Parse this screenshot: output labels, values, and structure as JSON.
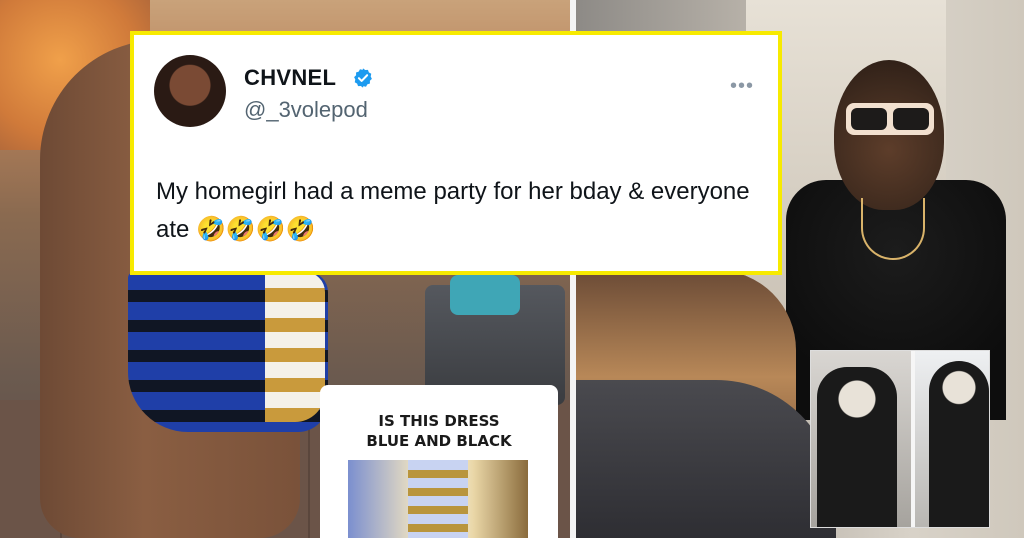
{
  "tweet": {
    "display_name": "CHVNEL",
    "handle": "@_3volepod",
    "text": "My homegirl had a meme party for her bday & everyone ate 🤣🤣🤣🤣",
    "more_icon": "more-horizontal-icon",
    "verified_icon": "verified-badge-icon",
    "verified_color": "#1d9bf0",
    "border_color": "#f7ea00"
  },
  "meme_card": {
    "caption_line1": "IS THIS DRESS",
    "caption_line2": "BLUE AND BLACK"
  }
}
